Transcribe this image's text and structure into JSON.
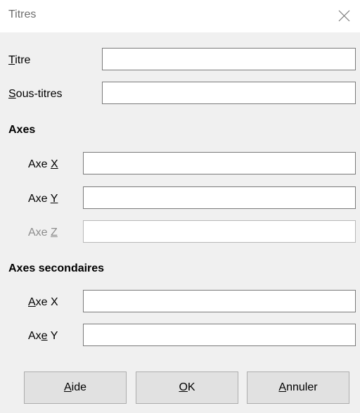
{
  "window": {
    "title": "Titres",
    "close_icon": "close-icon"
  },
  "fields": {
    "titre": {
      "label_mn": "T",
      "label_rest": "itre",
      "value": ""
    },
    "sous_titres": {
      "label_mn": "S",
      "label_rest": "ous-titres",
      "value": ""
    }
  },
  "axes": {
    "heading": "Axes",
    "x": {
      "label_pre": "Axe ",
      "label_mn": "X",
      "label_post": "",
      "value": ""
    },
    "y": {
      "label_pre": "Axe ",
      "label_mn": "Y",
      "label_post": "",
      "value": ""
    },
    "z": {
      "label_pre": "Axe ",
      "label_mn": "Z",
      "label_post": "",
      "value": "",
      "disabled": true
    }
  },
  "secondary_axes": {
    "heading": "Axes secondaires",
    "x": {
      "label_pre": "",
      "label_mn": "A",
      "label_post": "xe X",
      "value": ""
    },
    "y": {
      "label_pre": "Ax",
      "label_mn": "e",
      "label_post": " Y",
      "value": ""
    }
  },
  "buttons": {
    "help": {
      "mn": "A",
      "rest": "ide"
    },
    "ok": {
      "mn": "O",
      "rest": "K"
    },
    "cancel": {
      "mn": "A",
      "rest": "nnuler"
    }
  }
}
